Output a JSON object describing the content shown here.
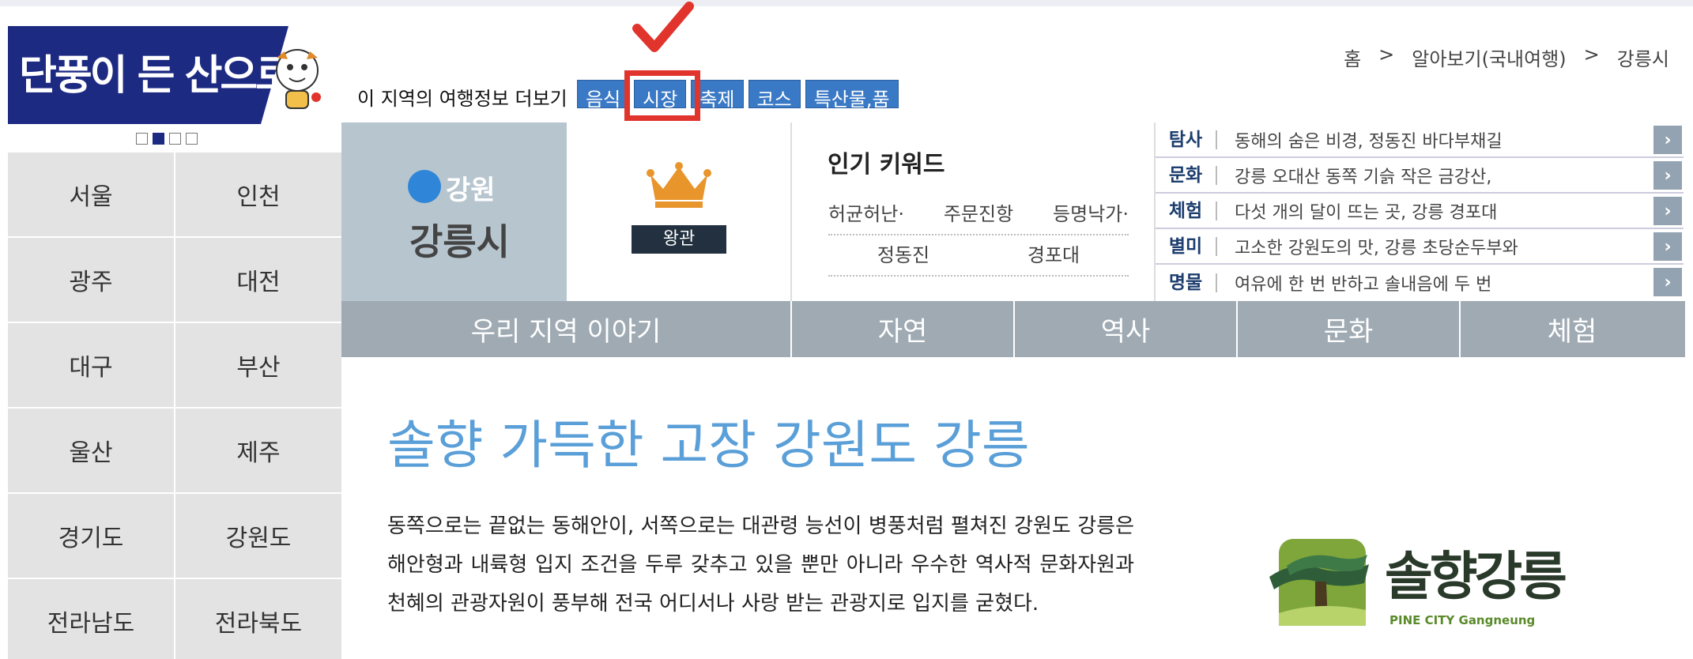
{
  "banner": {
    "title": "단풍이 든 산으로"
  },
  "sidebar": {
    "regions": [
      "서울",
      "인천",
      "광주",
      "대전",
      "대구",
      "부산",
      "울산",
      "제주",
      "경기도",
      "강원도",
      "전라남도",
      "전라북도"
    ]
  },
  "header": {
    "info_label": "이 지역의 여행정보 더보기",
    "tags": [
      "음식",
      "시장",
      "축제",
      "코스",
      "특산물,품"
    ],
    "breadcrumb": [
      "홈",
      ">",
      "알아보기(국내여행)",
      ">",
      "강릉시"
    ]
  },
  "city": {
    "province": "강원",
    "name": "강릉시",
    "badge": "왕관"
  },
  "keywords": {
    "title": "인기 키워드",
    "row1": [
      "허균허난·",
      "주문진항",
      "등명낙가·"
    ],
    "row2": [
      "정동진",
      "경포대"
    ]
  },
  "articles": [
    {
      "category": "탐사",
      "text": "동해의 숨은 비경, 정동진 바다부채길"
    },
    {
      "category": "문화",
      "text": "강릉 오대산 동쪽 기슭 작은 금강산,"
    },
    {
      "category": "체험",
      "text": "다섯 개의 달이 뜨는 곳, 강릉 경포대"
    },
    {
      "category": "별미",
      "text": "고소한 강원도의 맛, 강릉 초당순두부와"
    },
    {
      "category": "명물",
      "text": "여유에 한 번 반하고 솔내음에 두 번"
    }
  ],
  "tabs": [
    "우리 지역 이야기",
    "자연",
    "역사",
    "문화",
    "체험"
  ],
  "main": {
    "headline": "솔향 가득한 고장 강원도 강릉",
    "body": "동쪽으로는 끝없는 동해안이, 서쪽으로는 대관령 능선이 병풍처럼 펼쳐진 강원도 강릉은 해안형과 내륙형 입지 조건을 두루 갖추고 있을 뿐만 아니라 우수한 역사적 문화자원과 천혜의 관광자원이 풍부해 전국 어디서나 사랑 받는 관광지로 입지를 굳혔다."
  },
  "logo": {
    "text": "솔향강릉",
    "sub": "PINE CITY Gangneung"
  },
  "colors": {
    "accent": "#3a79c5",
    "highlight": "#e0342c",
    "headline": "#5a9fd8",
    "tabbar": "#9faab3"
  }
}
